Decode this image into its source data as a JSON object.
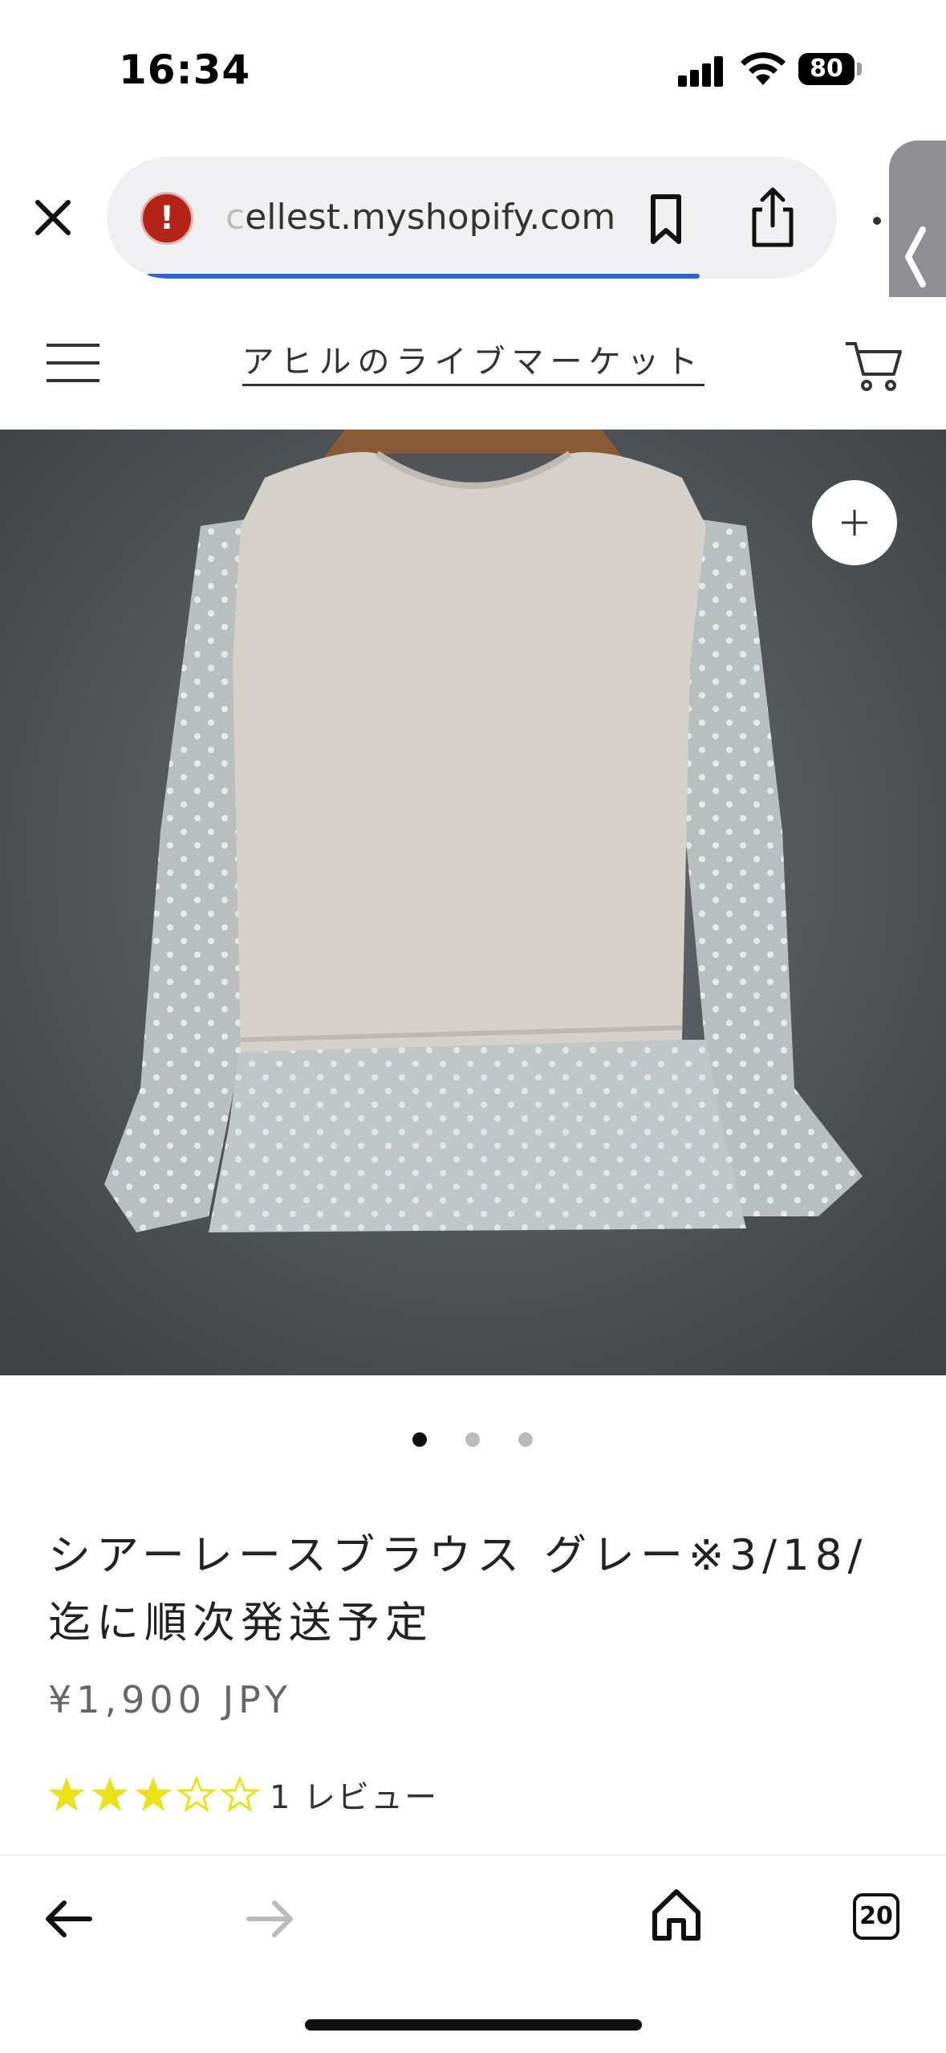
{
  "status_bar": {
    "time": "16:34",
    "battery": "80"
  },
  "browser": {
    "url_faded": "c",
    "url": "ellest.myshopify.com",
    "progress": 0.85,
    "accent_color": "#2a64d8"
  },
  "store": {
    "name": "アヒルのライブマーケット"
  },
  "product": {
    "title": "シアーレースブラウス グレー※3/18/迄に順次発送予定",
    "price": "¥1,900 JPY",
    "rating": 3,
    "rating_max": 5,
    "review_count": "1 レビュー",
    "image_count": 3,
    "active_image": 1
  },
  "toolbar": {
    "tab_count": "20"
  },
  "icons": {
    "close": "close-icon",
    "alert": "alert-icon",
    "bookmark": "bookmark-icon",
    "share": "share-icon",
    "menu": "hamburger-icon",
    "cart": "cart-icon",
    "zoom": "plus-icon",
    "back": "arrow-left-icon",
    "forward": "arrow-right-icon",
    "home": "home-icon",
    "tabs": "tabs-icon"
  },
  "colors": {
    "star": "#e9e21a",
    "star_empty_outline": "#e9e21a"
  }
}
